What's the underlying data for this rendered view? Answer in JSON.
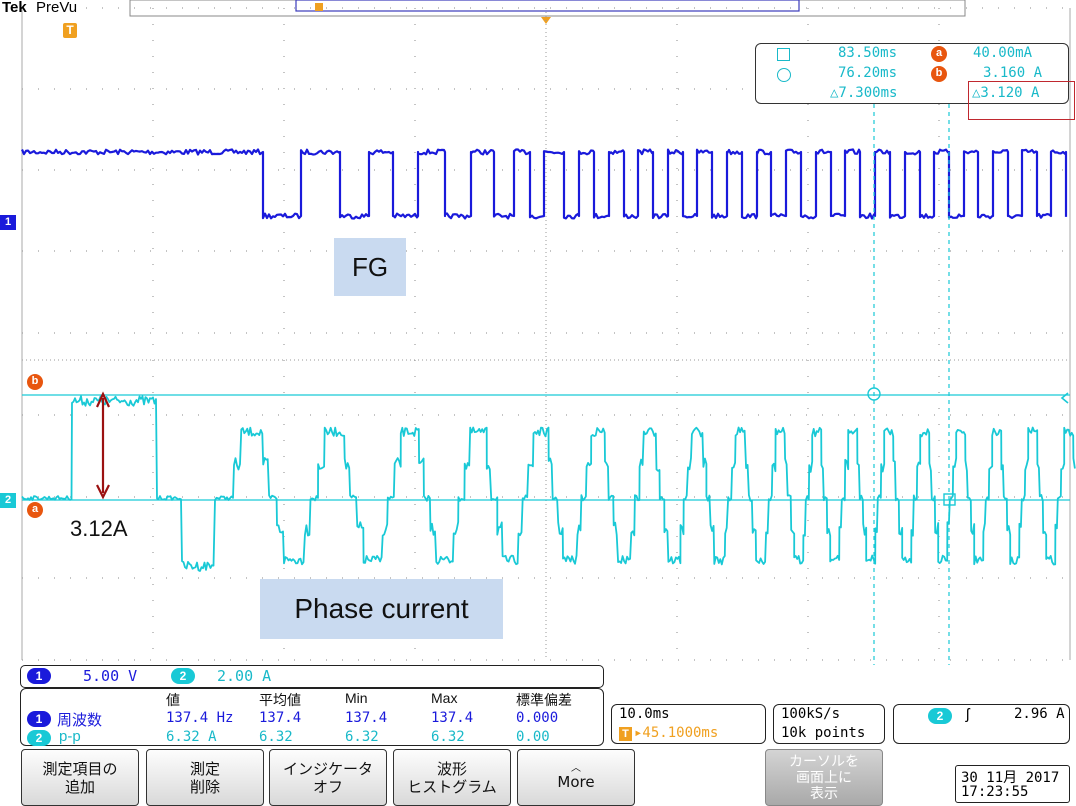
{
  "header": {
    "brand": "Tek",
    "mode": "PreVu",
    "trigger_marker": "T"
  },
  "colors": {
    "ch1": "#1a1adb",
    "ch2": "#19c9d6",
    "cursor_ref": "#e8560f",
    "trigger": "#f0a020",
    "highlight_box": "#c0282f",
    "annotation_bg": "#c9daf0",
    "arrow": "#9b1111"
  },
  "cursor_readout": {
    "row1_time": "83.50ms",
    "row1_badge": "a",
    "row1_value": "40.00mA",
    "row2_time": "76.20ms",
    "row2_badge": "b",
    "row2_value": "3.160 A",
    "delta_time": "△7.300ms",
    "delta_value": "△3.120 A"
  },
  "channel_markers": {
    "ch1": "1",
    "ch2": "2",
    "ref_a": "a",
    "ref_b": "b"
  },
  "annotations": {
    "fg": "FG",
    "amplitude": "3.12A",
    "phase": "Phase current"
  },
  "channel_scale": {
    "ch1_num": "1",
    "ch1_scale": "5.00 V",
    "ch2_num": "2",
    "ch2_scale": "2.00 A"
  },
  "measurements": {
    "headers": [
      "値",
      "平均値",
      "Min",
      "Max",
      "標準偏差"
    ],
    "rows": [
      {
        "ch": "1",
        "name": "周波数",
        "values": [
          "137.4 Hz",
          "137.4",
          "137.4",
          "137.4",
          "0.000"
        ]
      },
      {
        "ch": "2",
        "name": "p-p",
        "values": [
          "6.32 A",
          "6.32",
          "6.32",
          "6.32",
          "0.00"
        ]
      }
    ]
  },
  "timebase": {
    "scale": "10.0ms",
    "trigger_pos": "▸45.1000ms",
    "trigger_icon": "T"
  },
  "acquisition": {
    "rate": "100kS/s",
    "points": "10k points"
  },
  "trigger_info": {
    "ch": "2",
    "slope": "ʃ",
    "level": "2.96 A"
  },
  "softkeys": [
    "測定項目の\n追加",
    "測定\n削除",
    "インジケータ\nオフ",
    "波形\nヒストグラム",
    "More",
    "カーソルを\n画面上に\n表示"
  ],
  "more_icon": "chevron-up-icon",
  "datetime": {
    "date": "30 11月 2017",
    "time": "17:23:55"
  }
}
